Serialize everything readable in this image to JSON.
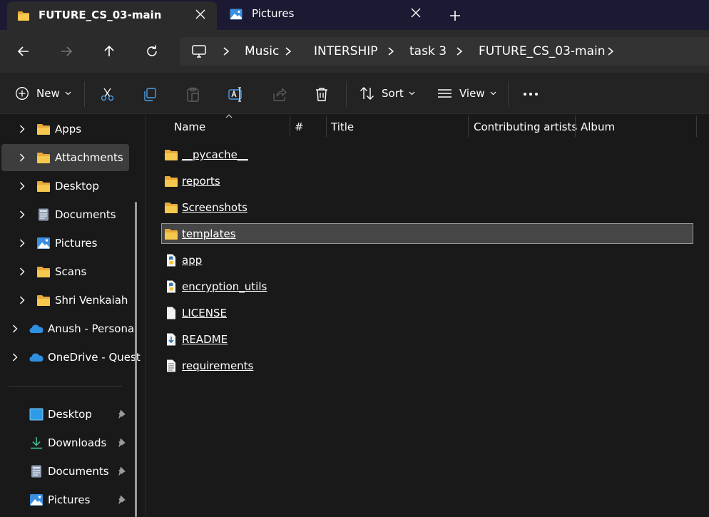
{
  "tabs": [
    {
      "title": "FUTURE_CS_03-main",
      "icon": "folder-icon",
      "active": true
    },
    {
      "title": "Pictures",
      "icon": "pictures-icon",
      "active": false
    }
  ],
  "breadcrumb": [
    "Music",
    "INTERSHIP",
    "task 3",
    "FUTURE_CS_03-main"
  ],
  "toolbar": {
    "new_label": "New",
    "sort_label": "Sort",
    "view_label": "View"
  },
  "nav": {
    "tree": [
      {
        "label": "Apps",
        "icon": "folder-icon"
      },
      {
        "label": "Attachments",
        "icon": "folder-icon",
        "selected": true
      },
      {
        "label": "Desktop",
        "icon": "folder-icon"
      },
      {
        "label": "Documents",
        "icon": "documents-icon"
      },
      {
        "label": "Pictures",
        "icon": "pictures-icon"
      },
      {
        "label": "Scans",
        "icon": "folder-icon"
      },
      {
        "label": "Shri Venkaiah N",
        "icon": "folder-icon"
      },
      {
        "label": "Anush - Personal",
        "icon": "onedrive-icon"
      },
      {
        "label": "OneDrive - Quest",
        "icon": "onedrive-icon"
      }
    ],
    "quick_access": [
      {
        "label": "Desktop",
        "icon": "desktop-icon"
      },
      {
        "label": "Downloads",
        "icon": "downloads-icon"
      },
      {
        "label": "Documents",
        "icon": "documents-icon"
      },
      {
        "label": "Pictures",
        "icon": "pictures-icon"
      }
    ]
  },
  "columns": [
    "Name",
    "#",
    "Title",
    "Contributing artists",
    "Album"
  ],
  "files": [
    {
      "name": "__pycache__",
      "icon": "folder-icon"
    },
    {
      "name": "reports",
      "icon": "folder-icon"
    },
    {
      "name": "Screenshots",
      "icon": "folder-icon"
    },
    {
      "name": "templates",
      "icon": "folder-icon",
      "selected": true
    },
    {
      "name": "app",
      "icon": "python-file-icon"
    },
    {
      "name": "encryption_utils",
      "icon": "python-file-icon"
    },
    {
      "name": "LICENSE",
      "icon": "blank-file-icon"
    },
    {
      "name": "README",
      "icon": "markdown-file-icon"
    },
    {
      "name": "requirements",
      "icon": "text-file-icon"
    }
  ],
  "colors": {
    "tab_strip": "#1c1a32",
    "toolbar": "#2b2b2b",
    "background": "#191919",
    "selection": "#464646",
    "folder": "#f2c04a",
    "onedrive": "#2f8fe0"
  }
}
